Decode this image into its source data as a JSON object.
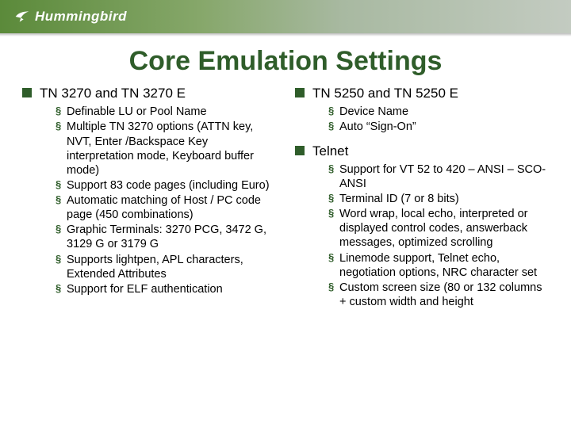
{
  "brand": "Hummingbird",
  "title": "Core Emulation Settings",
  "left": {
    "heading": "TN 3270 and TN 3270 E",
    "items": [
      "Definable LU or Pool Name",
      "Multiple TN 3270 options (ATTN key, NVT, Enter /Backspace Key interpretation mode, Keyboard buffer mode)",
      "Support 83 code pages (including Euro)",
      "Automatic matching of Host / PC code page (450 combinations)",
      "Graphic Terminals: 3270 PCG, 3472 G, 3129 G or 3179 G",
      "Supports lightpen, APL characters, Extended Attributes",
      "Support for ELF authentication"
    ]
  },
  "right_a": {
    "heading": "TN 5250 and TN 5250 E",
    "items": [
      "Device Name",
      "Auto “Sign-On”"
    ]
  },
  "right_b": {
    "heading": "Telnet",
    "items": [
      "Support for VT 52 to 420 – ANSI – SCO-ANSI",
      "Terminal ID (7 or 8 bits)",
      "Word wrap, local echo, interpreted or displayed control codes, answerback messages, optimized scrolling",
      "Linemode support, Telnet echo, negotiation options, NRC character set",
      "Custom screen size (80 or 132 columns + custom width and height"
    ]
  }
}
